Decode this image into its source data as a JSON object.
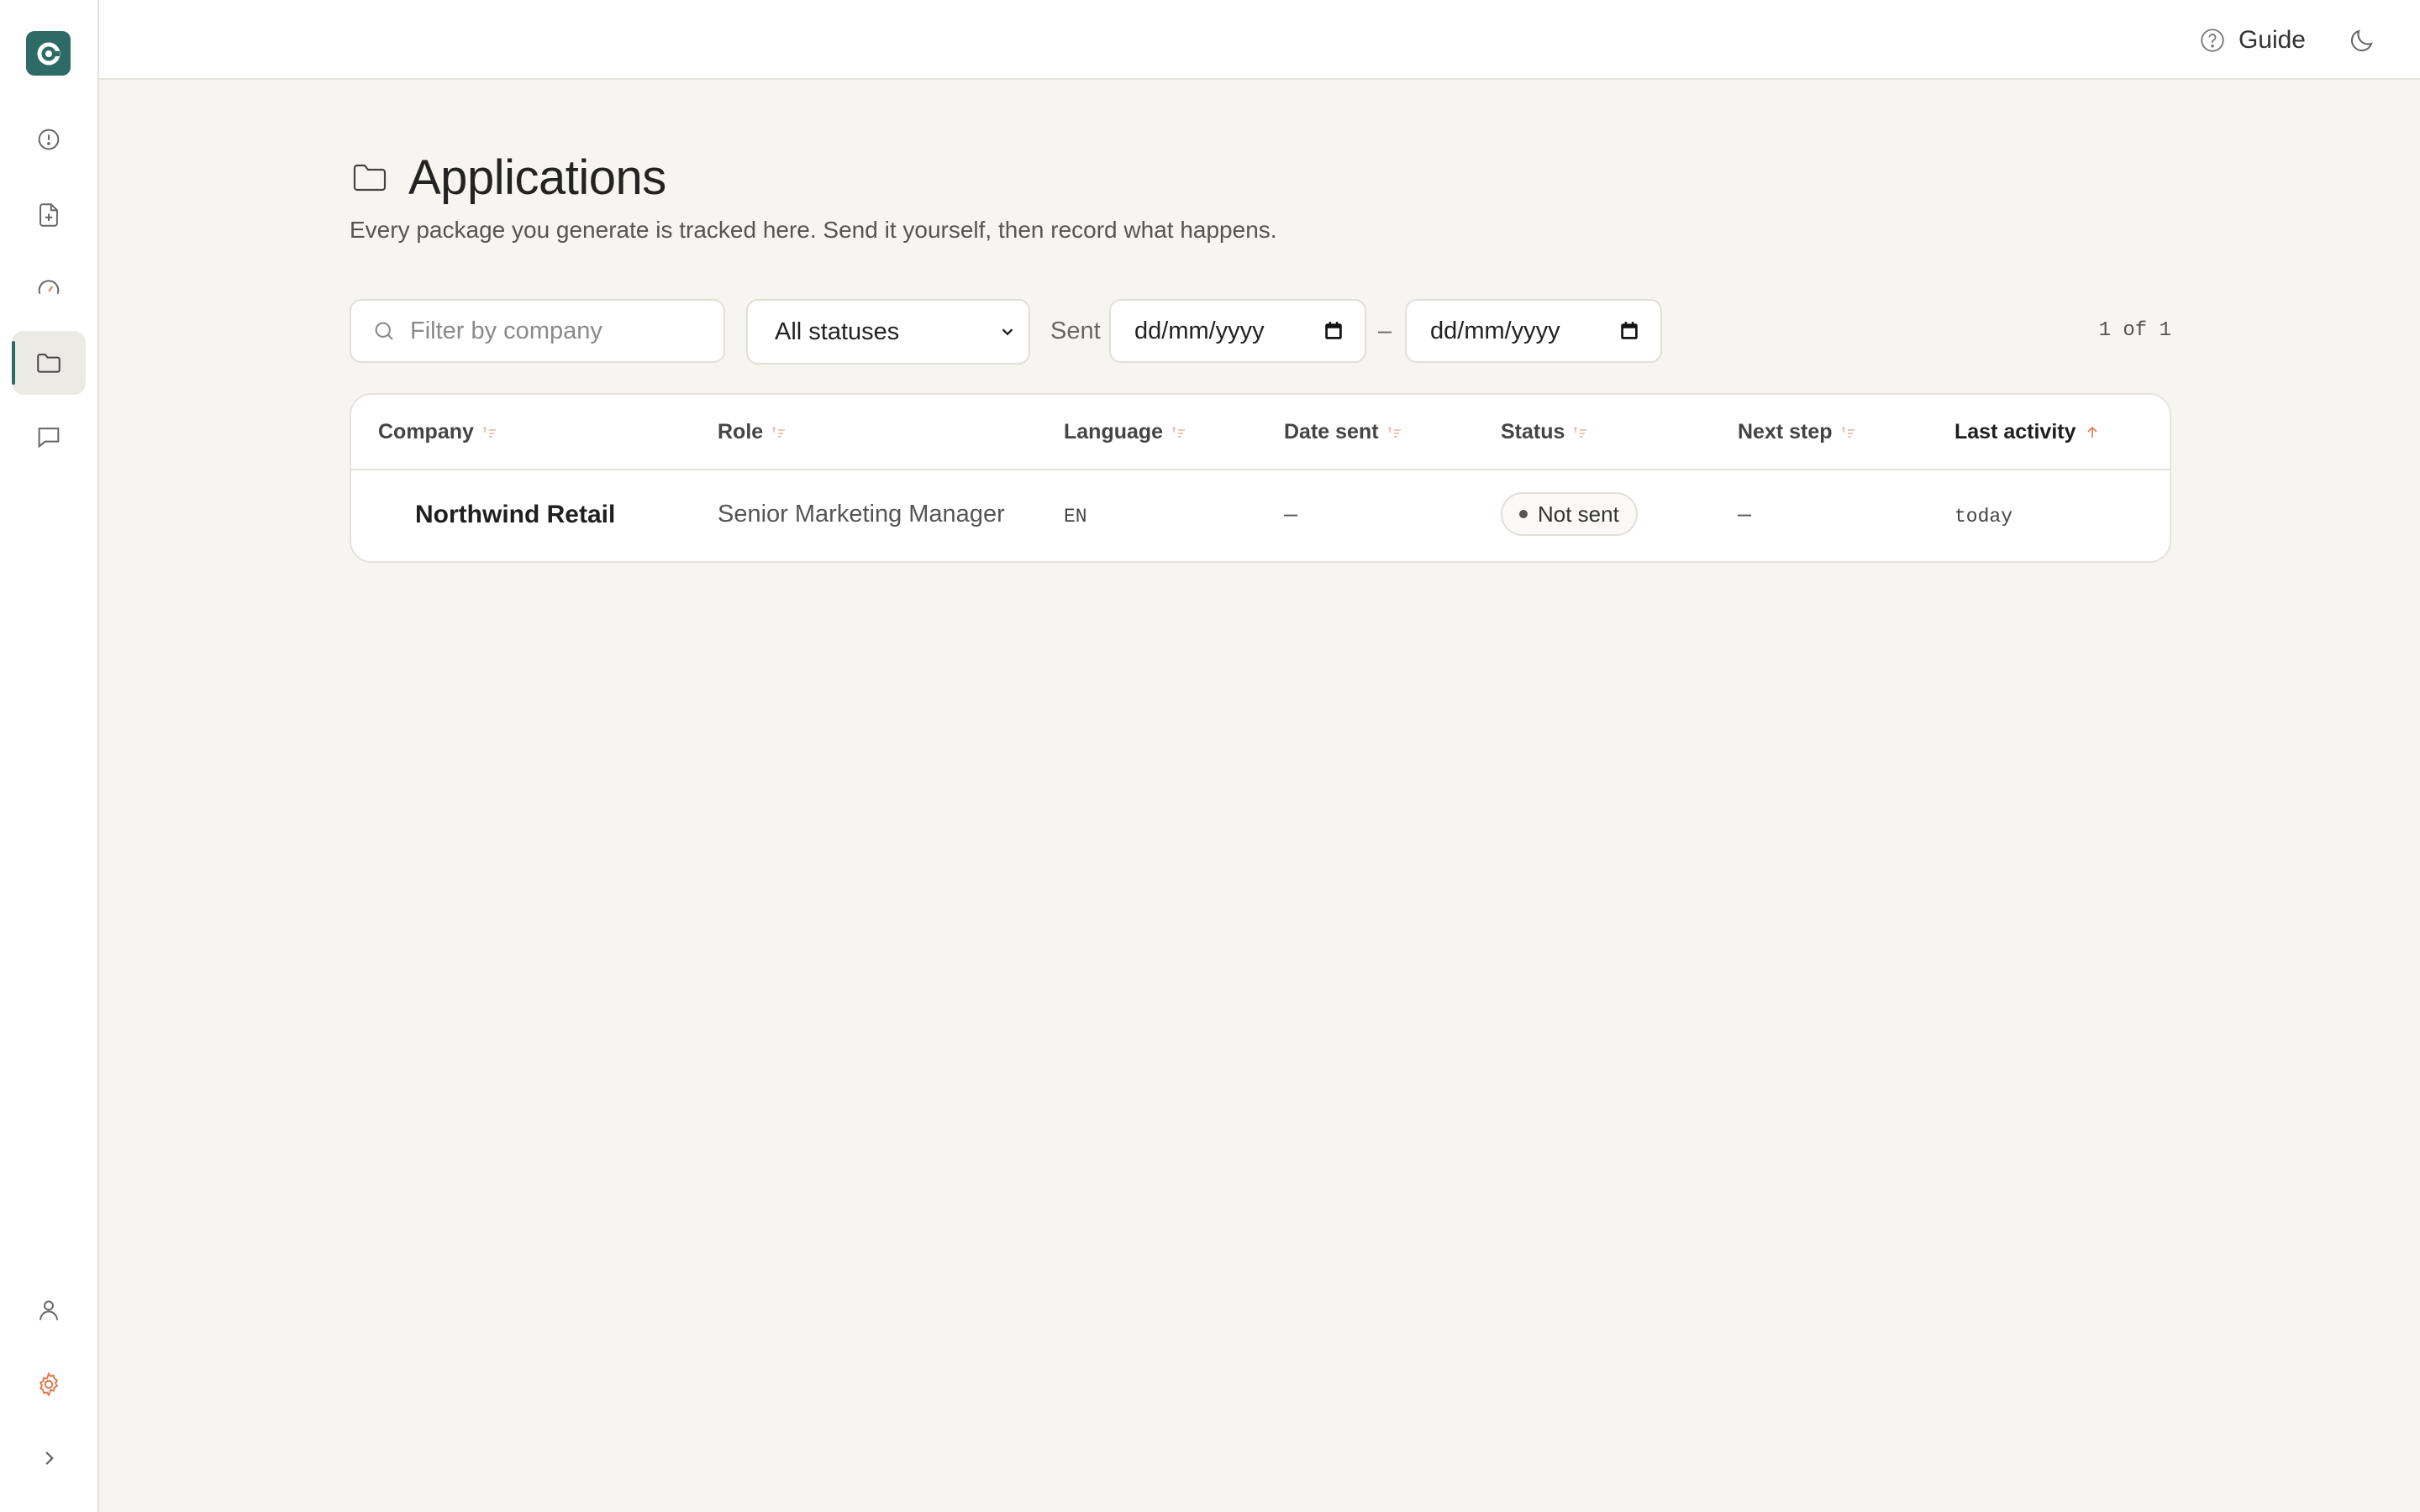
{
  "colors": {
    "accent": "#2f6b66",
    "background": "#f7f5f1",
    "sort_indicator": "#e07a4f"
  },
  "sidebar": {
    "logo": "app-logo",
    "items": [
      {
        "icon": "alert-circle-icon"
      },
      {
        "icon": "file-plus-icon"
      },
      {
        "icon": "gauge-icon"
      },
      {
        "icon": "folder-icon",
        "active": true
      },
      {
        "icon": "message-square-icon"
      }
    ],
    "bottom": [
      {
        "icon": "user-icon"
      },
      {
        "icon": "gear-icon"
      },
      {
        "icon": "chevron-right-icon"
      }
    ]
  },
  "topbar": {
    "guide_label": "Guide"
  },
  "page": {
    "title": "Applications",
    "subtitle": "Every package you generate is tracked here. Send it yourself, then record what happens."
  },
  "filters": {
    "search_placeholder": "Filter by company",
    "status_selected": "All statuses",
    "sent_label": "Sent",
    "date_from_placeholder": "dd/mm/yyyy",
    "date_separator": "–",
    "date_to_placeholder": "dd/mm/yyyy",
    "page_count": "1 of 1"
  },
  "table": {
    "columns": [
      "Company",
      "Role",
      "Language",
      "Date sent",
      "Status",
      "Next step",
      "Last activity"
    ],
    "sorted_column": "Last activity",
    "sort_direction": "ascending",
    "rows": [
      {
        "company": "Northwind Retail",
        "role": "Senior Marketing Manager",
        "language": "EN",
        "date_sent": "–",
        "status": "Not sent",
        "next_step": "–",
        "last_activity": "today"
      }
    ]
  }
}
